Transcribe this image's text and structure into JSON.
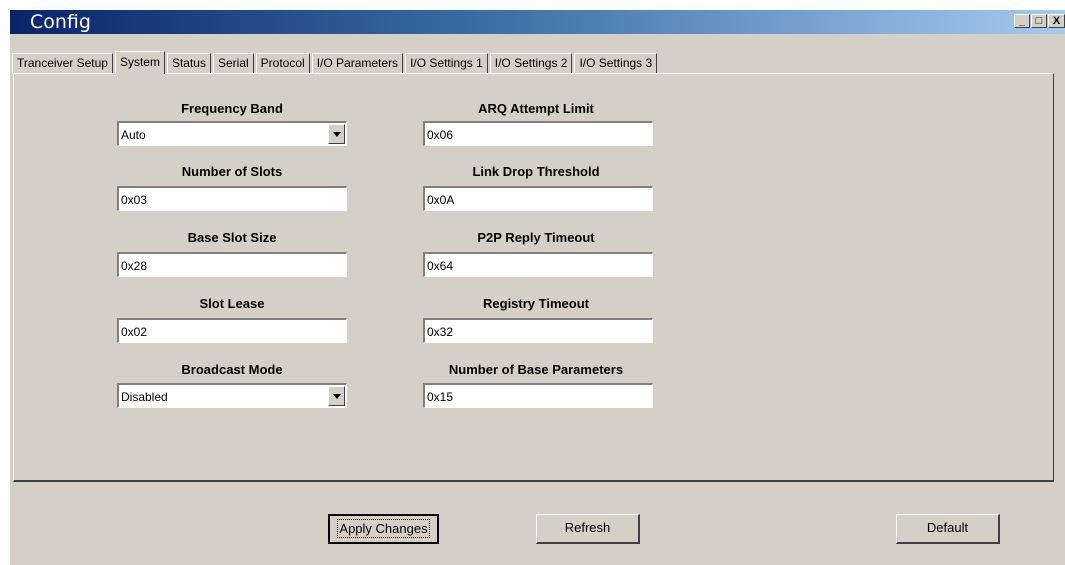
{
  "window": {
    "title": "Config"
  },
  "caption_buttons": {
    "minimize": "_",
    "maximize": "□",
    "close": "X"
  },
  "tabs": [
    {
      "label": "Tranceiver Setup",
      "active": false
    },
    {
      "label": "System",
      "active": true
    },
    {
      "label": "Status",
      "active": false
    },
    {
      "label": "Serial",
      "active": false
    },
    {
      "label": "Protocol",
      "active": false
    },
    {
      "label": "I/O Parameters",
      "active": false
    },
    {
      "label": "I/O Settings 1",
      "active": false
    },
    {
      "label": "I/O Settings 2",
      "active": false
    },
    {
      "label": "I/O Settings 3",
      "active": false
    }
  ],
  "left_fields": [
    {
      "label": "Frequency Band",
      "value": "Auto",
      "type": "dropdown"
    },
    {
      "label": "Number of Slots",
      "value": "0x03",
      "type": "text"
    },
    {
      "label": "Base Slot Size",
      "value": "0x28",
      "type": "text"
    },
    {
      "label": "Slot Lease",
      "value": "0x02",
      "type": "text"
    },
    {
      "label": "Broadcast Mode",
      "value": "Disabled",
      "type": "dropdown"
    }
  ],
  "right_fields": [
    {
      "label": "ARQ Attempt Limit",
      "value": "0x06",
      "type": "text"
    },
    {
      "label": "Link Drop Threshold",
      "value": "0x0A",
      "type": "text"
    },
    {
      "label": "P2P Reply Timeout",
      "value": "0x64",
      "type": "text"
    },
    {
      "label": "Registry Timeout",
      "value": "0x32",
      "type": "text"
    },
    {
      "label": "Number of Base Parameters",
      "value": "0x15",
      "type": "text"
    }
  ],
  "buttons": {
    "apply": "Apply Changes",
    "refresh": "Refresh",
    "default": "Default"
  }
}
